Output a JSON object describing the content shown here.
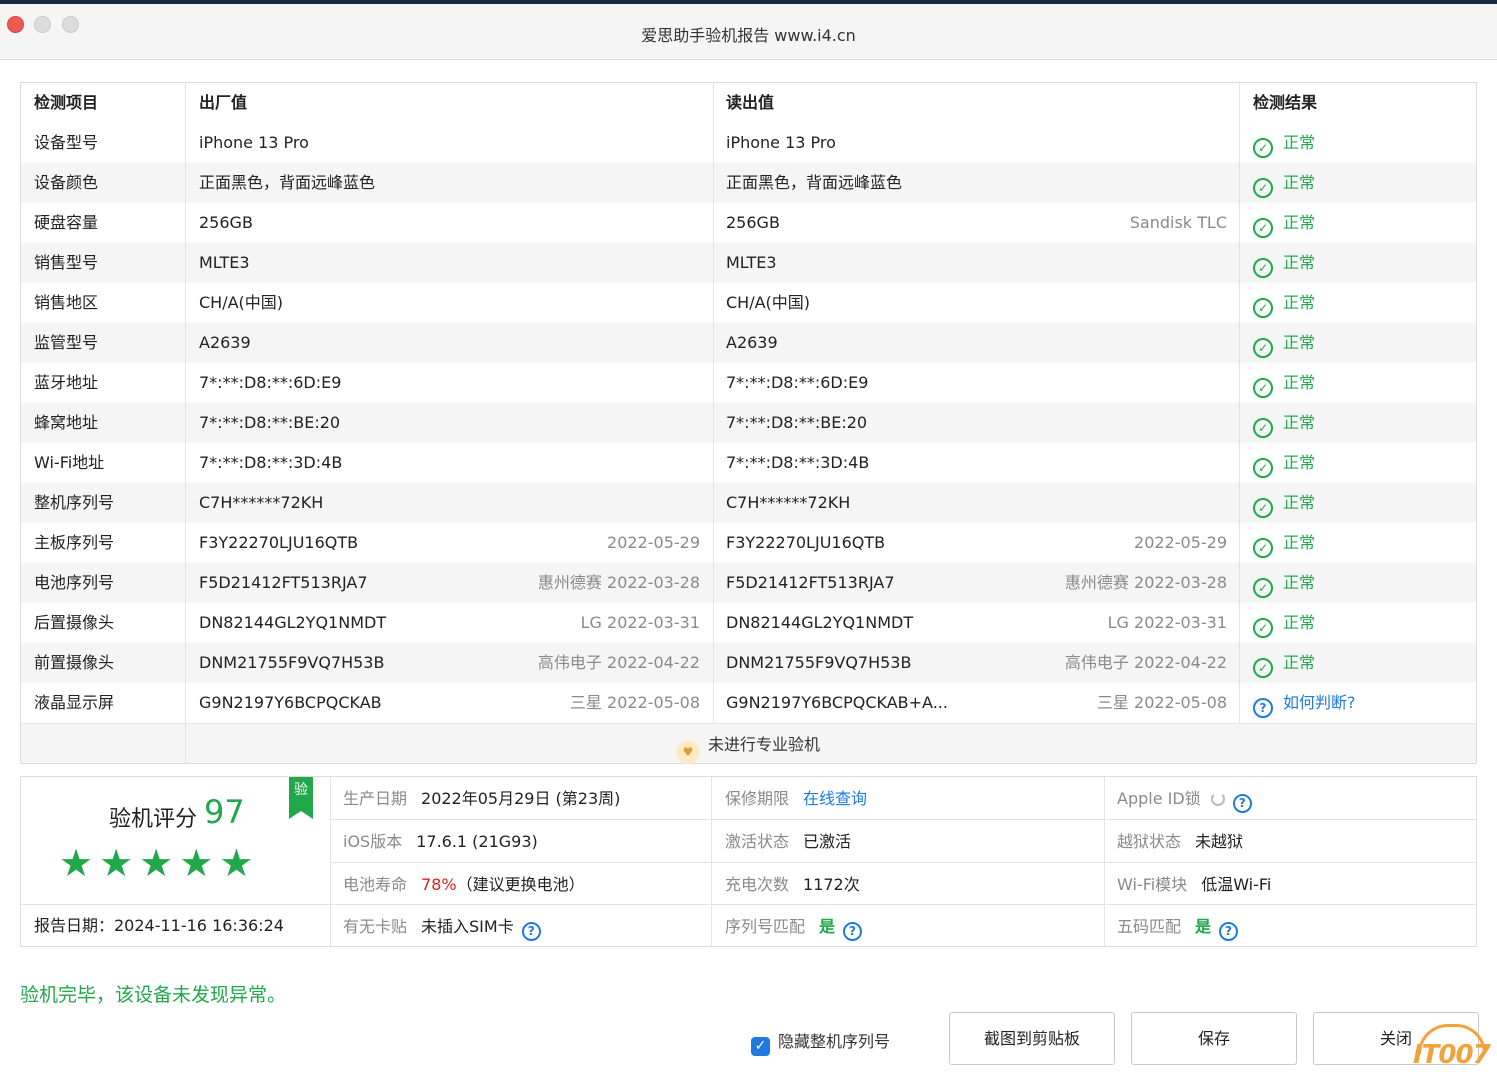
{
  "window": {
    "title": "爱思助手验机报告 www.i4.cn"
  },
  "table": {
    "headers": {
      "item": "检测项目",
      "factory": "出厂值",
      "read": "读出值",
      "result": "检测结果"
    },
    "rows": [
      {
        "item": "设备型号",
        "factory": "iPhone 13 Pro",
        "factory_note": "",
        "read": "iPhone 13 Pro",
        "read_note": "",
        "result": "正常"
      },
      {
        "item": "设备颜色",
        "factory": "正面黑色，背面远峰蓝色",
        "factory_note": "",
        "read": "正面黑色，背面远峰蓝色",
        "read_note": "",
        "result": "正常"
      },
      {
        "item": "硬盘容量",
        "factory": "256GB",
        "factory_note": "",
        "read": "256GB",
        "read_note": "Sandisk TLC",
        "result": "正常"
      },
      {
        "item": "销售型号",
        "factory": "MLTE3",
        "factory_note": "",
        "read": "MLTE3",
        "read_note": "",
        "result": "正常"
      },
      {
        "item": "销售地区",
        "factory": "CH/A(中国)",
        "factory_note": "",
        "read": "CH/A(中国)",
        "read_note": "",
        "result": "正常"
      },
      {
        "item": "监管型号",
        "factory": "A2639",
        "factory_note": "",
        "read": "A2639",
        "read_note": "",
        "result": "正常"
      },
      {
        "item": "蓝牙地址",
        "factory": "7*:**:D8:**:6D:E9",
        "factory_note": "",
        "read": "7*:**:D8:**:6D:E9",
        "read_note": "",
        "result": "正常"
      },
      {
        "item": "蜂窝地址",
        "factory": "7*:**:D8:**:BE:20",
        "factory_note": "",
        "read": "7*:**:D8:**:BE:20",
        "read_note": "",
        "result": "正常"
      },
      {
        "item": "Wi-Fi地址",
        "factory": "7*:**:D8:**:3D:4B",
        "factory_note": "",
        "read": "7*:**:D8:**:3D:4B",
        "read_note": "",
        "result": "正常"
      },
      {
        "item": "整机序列号",
        "factory": "C7H******72KH",
        "factory_note": "",
        "read": "C7H******72KH",
        "read_note": "",
        "result": "正常"
      },
      {
        "item": "主板序列号",
        "factory": "F3Y22270LJU16QTB",
        "factory_note": "2022-05-29",
        "read": "F3Y22270LJU16QTB",
        "read_note": "2022-05-29",
        "result": "正常"
      },
      {
        "item": "电池序列号",
        "factory": "F5D21412FT513RJA7",
        "factory_note": "惠州德赛 2022-03-28",
        "read": "F5D21412FT513RJA7",
        "read_note": "惠州德赛 2022-03-28",
        "result": "正常"
      },
      {
        "item": "后置摄像头",
        "factory": "DN82144GL2YQ1NMDT",
        "factory_note": "LG 2022-03-31",
        "read": "DN82144GL2YQ1NMDT",
        "read_note": "LG 2022-03-31",
        "result": "正常"
      },
      {
        "item": "前置摄像头",
        "factory": "DNM21755F9VQ7H53B",
        "factory_note": "高伟电子 2022-04-22",
        "read": "DNM21755F9VQ7H53B",
        "read_note": "高伟电子 2022-04-22",
        "result": "正常"
      },
      {
        "item": "液晶显示屏",
        "factory": "G9N2197Y6BCPQCKAB",
        "factory_note": "三星 2022-05-08",
        "read": "G9N2197Y6BCPQCKAB+A...",
        "read_note": "三星 2022-05-08",
        "result": "如何判断?"
      }
    ],
    "footer_note": "未进行专业验机"
  },
  "summary": {
    "score_label": "验机评分",
    "score": "97",
    "stars": 5,
    "badge": "验",
    "report_date": "报告日期：2024-11-16 16:36:24",
    "fields": {
      "production_date": {
        "label": "生产日期",
        "value": "2022年05月29日 (第23周)"
      },
      "warranty": {
        "label": "保修期限",
        "value": "在线查询"
      },
      "apple_id_lock": {
        "label": "Apple ID锁",
        "value": ""
      },
      "ios_version": {
        "label": "iOS版本",
        "value": "17.6.1 (21G93)"
      },
      "activation": {
        "label": "激活状态",
        "value": "已激活"
      },
      "jailbreak": {
        "label": "越狱状态",
        "value": "未越狱"
      },
      "battery_life": {
        "label": "电池寿命",
        "value": "78%",
        "note": "（建议更换电池）"
      },
      "charge_cycles": {
        "label": "充电次数",
        "value": "1172次"
      },
      "wifi_module": {
        "label": "Wi-Fi模块",
        "value": "低温Wi-Fi"
      },
      "sim_card": {
        "label": "有无卡贴",
        "value": "未插入SIM卡"
      },
      "serial_match": {
        "label": "序列号匹配",
        "value": "是"
      },
      "five_code_match": {
        "label": "五码匹配",
        "value": "是"
      }
    }
  },
  "status_message": "验机完毕，该设备未发现异常。",
  "actions": {
    "hide_serial_label": "隐藏整机序列号",
    "hide_serial_checked": true,
    "screenshot_label": "截图到剪贴板",
    "save_label": "保存",
    "close_label": "关闭"
  },
  "watermark": "IT007",
  "colors": {
    "ok_green": "#21a84a",
    "link_blue": "#1f7ae0",
    "warn_red": "#e02020"
  }
}
